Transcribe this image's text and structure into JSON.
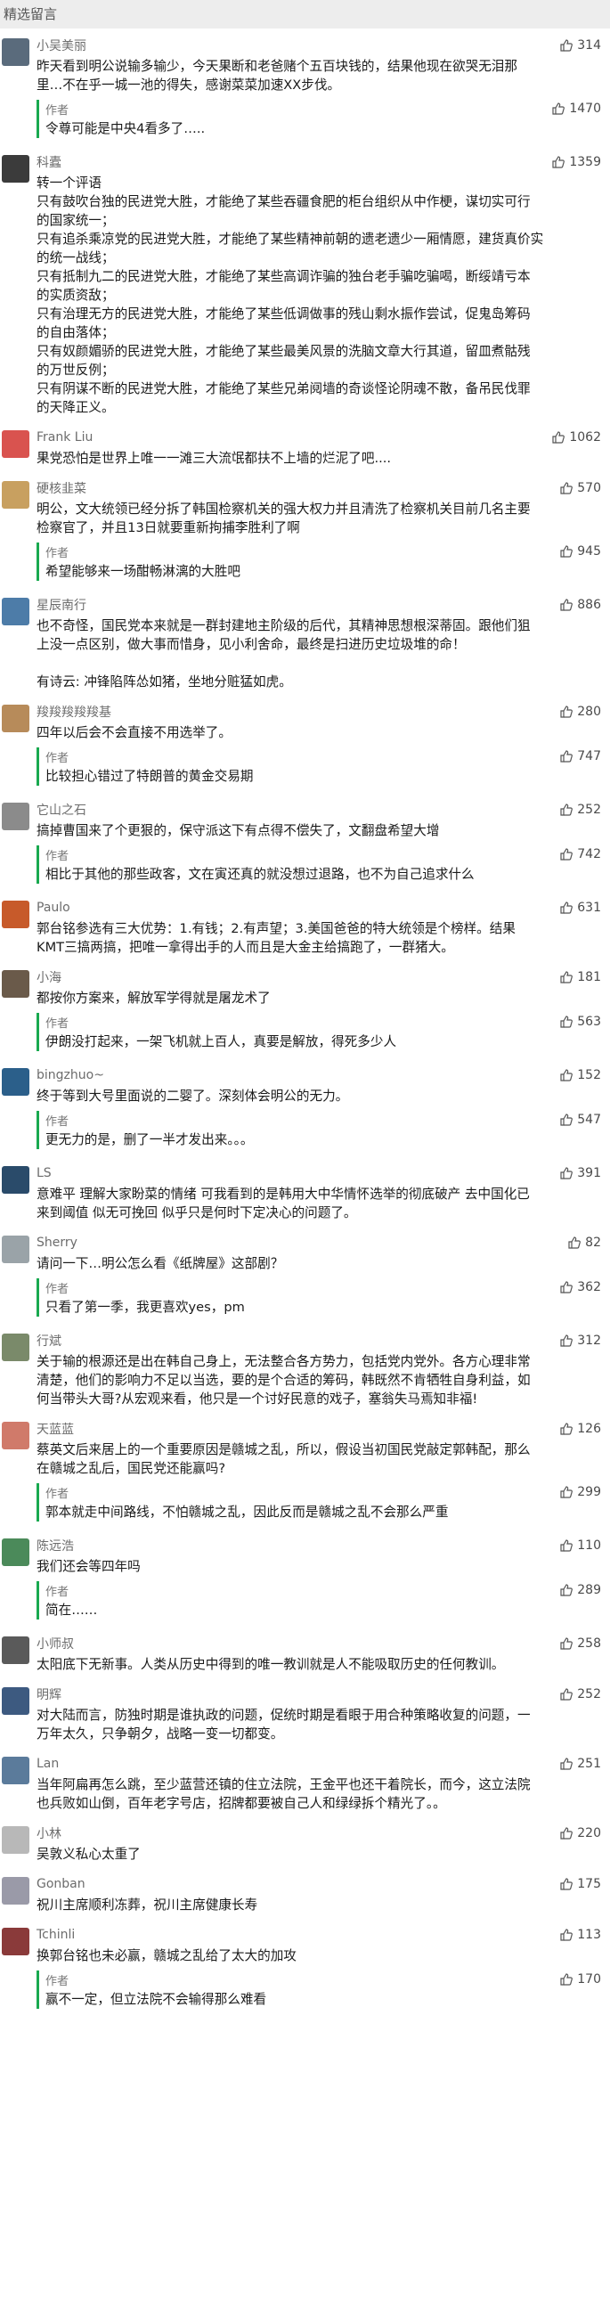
{
  "header": {
    "title": "精选留言"
  },
  "icons": {
    "like": "thumbs-up-icon"
  },
  "colors": {
    "author_bar": "#19a950",
    "header_bg": "#ededed"
  },
  "comments": [
    {
      "name": "小吴美丽",
      "likes": "314",
      "lines": [
        "昨天看到明公说输多输少，今天果断和老爸赌个五百块钱的，结果他现在欲哭无泪那",
        "里…不在乎一城一池的得失，感谢菜菜加速XX步伐。"
      ],
      "reply": {
        "tag": "作者",
        "likes": "1470",
        "lines": [
          "令尊可能是中央4看多了….."
        ]
      }
    },
    {
      "name": "科蠹",
      "likes": "1359",
      "lines": [
        "转一个评语",
        "只有鼓吹台独的民进党大胜，才能绝了某些吞疆食肥的柜台组织从中作梗，谋切实可行",
        "的国家统一；",
        "只有追杀乘凉党的民进党大胜，才能绝了某些精神前朝的遗老遗少一厢情愿，建货真价实",
        "的统一战线；",
        "只有抵制九二的民进党大胜，才能绝了某些高调诈骗的独台老手骗吃骗喝，断绥靖亏本",
        "的实质资敌；",
        "只有治理无方的民进党大胜，才能绝了某些低调做事的残山剩水振作尝试，促鬼岛筹码",
        "的自由落体；",
        "只有奴颜媚骄的民进党大胜，才能绝了某些最美风景的洗脑文章大行其道，留皿煮骷残",
        "的万世反例；",
        "只有阴谋不断的民进党大胜，才能绝了某些兄弟阋墙的奇谈怪论阴魂不散，备吊民伐罪",
        "的天降正义。"
      ]
    },
    {
      "name": "Frank Liu",
      "likes": "1062",
      "lines": [
        "果党恐怕是世界上唯一一滩三大流氓都扶不上墙的烂泥了吧...."
      ]
    },
    {
      "name": "硬核韭菜",
      "likes": "570",
      "lines": [
        "明公，文大统领已经分拆了韩国检察机关的强大权力并且清洗了检察机关目前几名主要",
        "检察官了，并且13日就要重新拘捕李胜利了啊"
      ],
      "reply": {
        "tag": "作者",
        "likes": "945",
        "lines": [
          "希望能够来一场酣畅淋漓的大胜吧"
        ]
      }
    },
    {
      "name": "星辰南行",
      "likes": "886",
      "lines": [
        "也不奇怪，国民党本来就是一群封建地主阶级的后代，其精神思想根深蒂固。跟他们狙",
        "上没一点区别，做大事而惜身，见小利舍命，最终是扫进历史垃圾堆的命！",
        "",
        "有诗云: 冲锋陷阵怂如猪，坐地分赃猛如虎。"
      ]
    },
    {
      "name": "羧羧羧羧羧基",
      "likes": "280",
      "lines": [
        "四年以后会不会直接不用选举了。"
      ],
      "reply": {
        "tag": "作者",
        "likes": "747",
        "lines": [
          "比较担心错过了特朗普的黄金交易期"
        ]
      }
    },
    {
      "name": "它山之石",
      "likes": "252",
      "lines": [
        "搞掉曹国来了个更狠的，保守派这下有点得不偿失了，文翻盘希望大增"
      ],
      "reply": {
        "tag": "作者",
        "likes": "742",
        "lines": [
          "相比于其他的那些政客，文在寅还真的就没想过退路，也不为自己追求什么"
        ]
      }
    },
    {
      "name": "Paulo",
      "likes": "631",
      "lines": [
        "郭台铭参选有三大优势：1.有钱；2.有声望；3.美国爸爸的特大统领是个榜样。结果",
        "KMT三搞两搞，把唯一拿得出手的人而且是大金主给搞跑了，一群猪大。"
      ]
    },
    {
      "name": "小海",
      "likes": "181",
      "lines": [
        "都按你方案来，解放军学得就是屠龙术了"
      ],
      "reply": {
        "tag": "作者",
        "likes": "563",
        "lines": [
          "伊朗没打起来，一架飞机就上百人，真要是解放，得死多少人"
        ]
      }
    },
    {
      "name": "bingzhuo~",
      "likes": "152",
      "lines": [
        "终于等到大号里面说的二婴了。深刻体会明公的无力。"
      ],
      "reply": {
        "tag": "作者",
        "likes": "547",
        "lines": [
          "更无力的是，删了一半才发出来。。。"
        ]
      }
    },
    {
      "name": "LS",
      "likes": "391",
      "lines": [
        "意难平 理解大家盼菜的情绪 可我看到的是韩用大中华情怀选举的彻底破产 去中国化已",
        "来到阈值 似无可挽回 似乎只是何时下定决心的问题了。"
      ]
    },
    {
      "name": "Sherry",
      "likes": "82",
      "lines": [
        "请问一下…明公怎么看《纸牌屋》这部剧？"
      ],
      "reply": {
        "tag": "作者",
        "likes": "362",
        "lines": [
          "只看了第一季，我更喜欢yes，pm"
        ]
      }
    },
    {
      "name": "行斌",
      "likes": "312",
      "lines": [
        "关于输的根源还是出在韩自己身上，无法整合各方势力，包括党内党外。各方心理非常",
        "清楚，他们的影响力不足以当选，要的是个合适的筹码，韩既然不肯牺牲自身利益，如",
        "何当带头大哥?从宏观来看，他只是一个讨好民意的戏子，塞翁失马焉知非福!"
      ]
    },
    {
      "name": "天蓝蓝",
      "likes": "126",
      "lines": [
        "蔡英文后来居上的一个重要原因是赣城之乱，所以，假设当初国民党敲定郭韩配，那么",
        "在赣城之乱后，国民党还能赢吗?"
      ],
      "reply": {
        "tag": "作者",
        "likes": "299",
        "lines": [
          "郭本就走中间路线，不怕赣城之乱，因此反而是赣城之乱不会那么严重"
        ]
      }
    },
    {
      "name": "陈远浩",
      "likes": "110",
      "lines": [
        "我们还会等四年吗"
      ],
      "reply": {
        "tag": "作者",
        "likes": "289",
        "lines": [
          "简在……"
        ]
      }
    },
    {
      "name": "小师叔",
      "likes": "258",
      "lines": [
        "太阳底下无新事。人类从历史中得到的唯一教训就是人不能吸取历史的任何教训。"
      ]
    },
    {
      "name": "明辉",
      "likes": "252",
      "lines": [
        "对大陆而言，防独时期是谁执政的问题，促统时期是看眼于用合种策略收复的问题，一",
        "万年太久，只争朝夕，战略一变一切都变。"
      ]
    },
    {
      "name": "Lan",
      "likes": "251",
      "lines": [
        "当年阿扁再怎么跳，至少蓝营还镇的住立法院，王金平也还干着院长，而今，这立法院",
        "也兵败如山倒，百年老字号店，招牌都要被自己人和绿绿拆个精光了。。"
      ]
    },
    {
      "name": "小林",
      "likes": "220",
      "lines": [
        "吴敦义私心太重了"
      ]
    },
    {
      "name": "Gonban",
      "likes": "175",
      "lines": [
        "祝川主席顺利冻葬，祝川主席健康长寿"
      ]
    },
    {
      "name": "Tchinli",
      "likes": "113",
      "lines": [
        "换郭台铭也未必赢，赣城之乱给了太大的加攻"
      ],
      "reply": {
        "tag": "作者",
        "likes": "170",
        "lines": [
          "赢不一定，但立法院不会输得那么难看"
        ]
      }
    }
  ]
}
